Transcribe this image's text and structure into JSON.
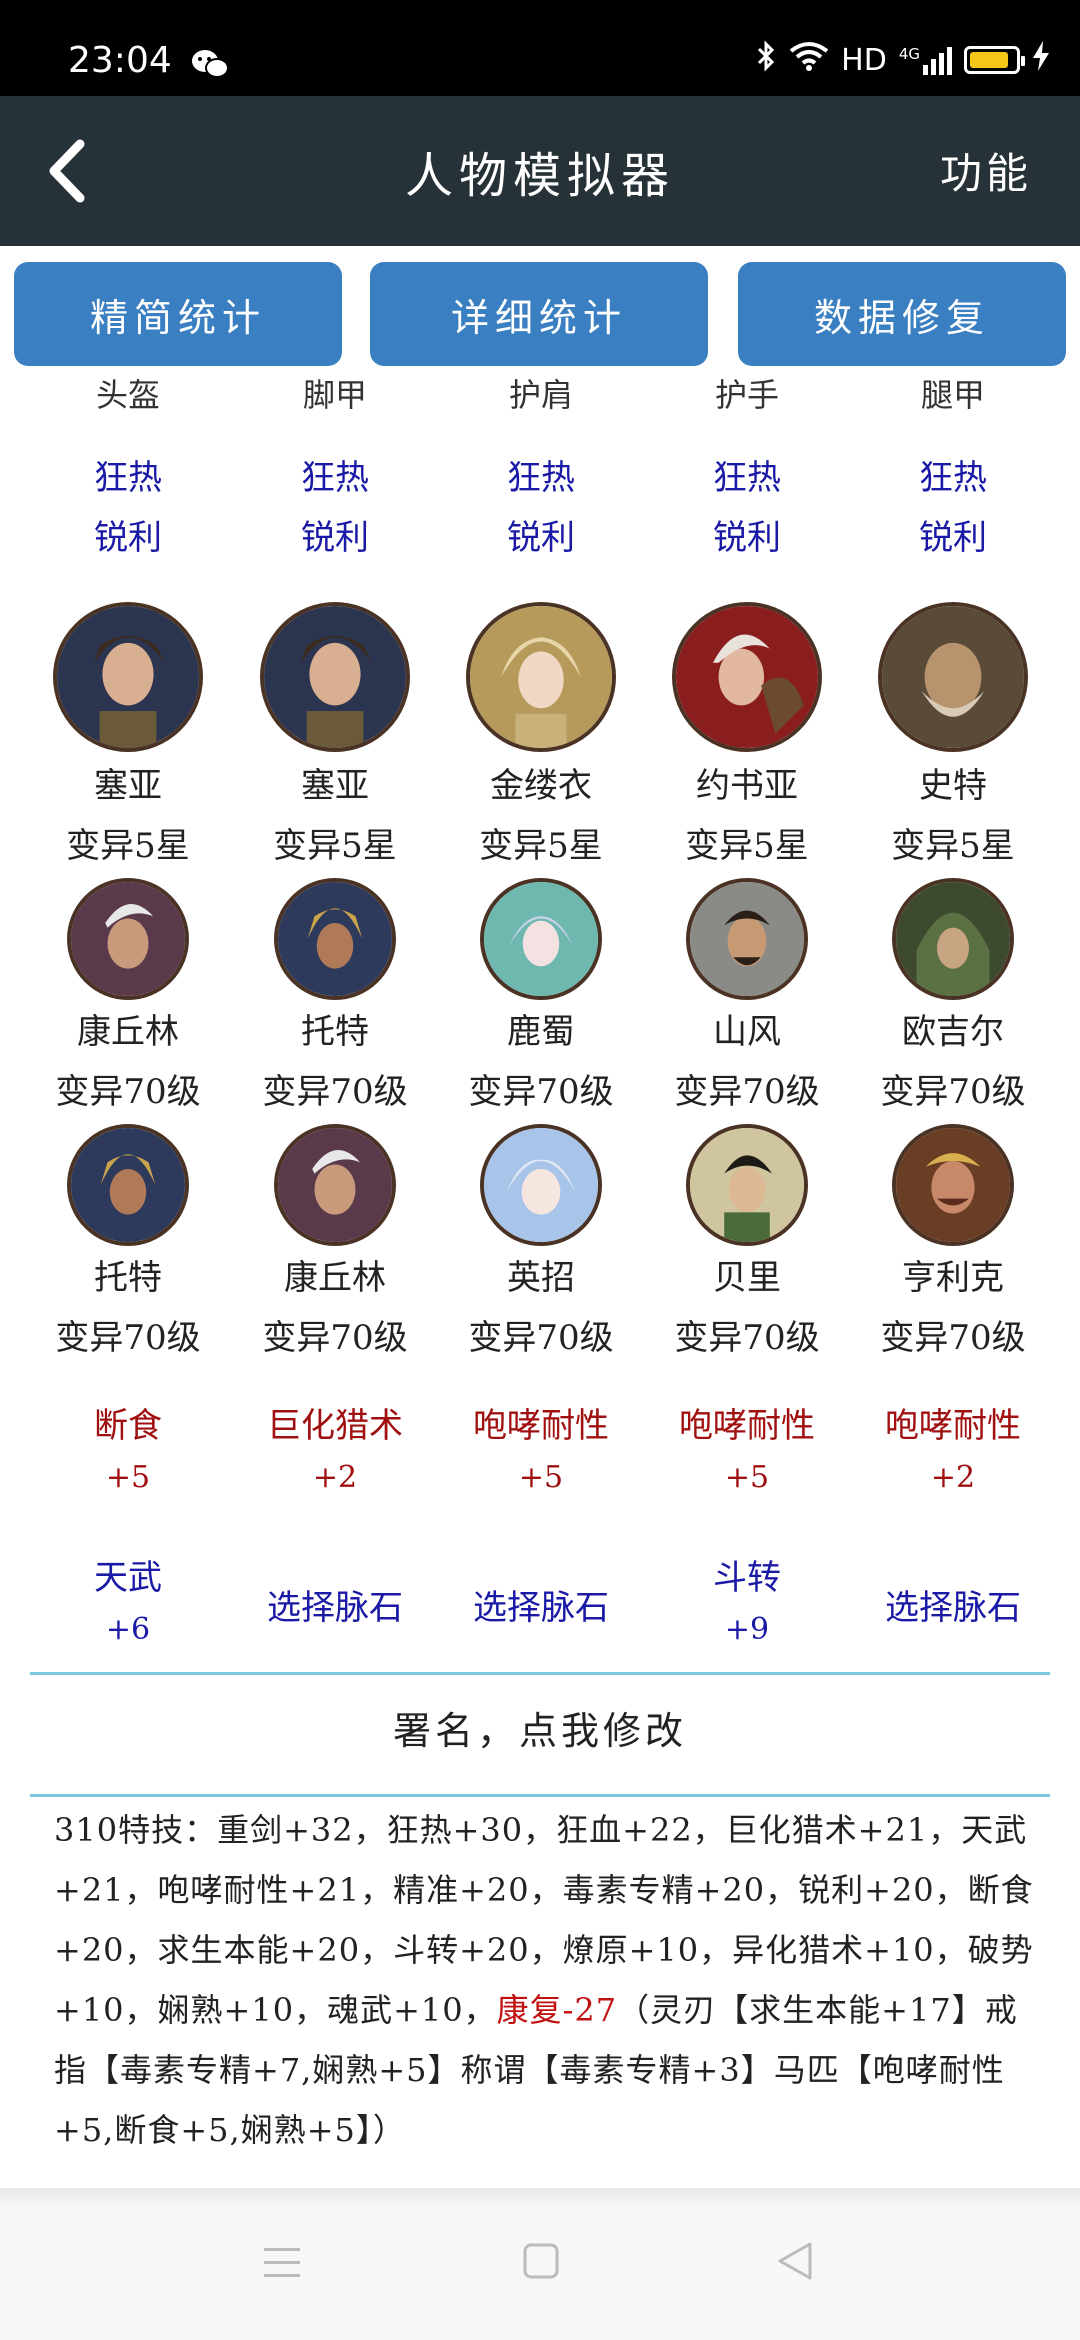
{
  "status_bar": {
    "time": "23:04",
    "network": "HD",
    "signal_label": "4G"
  },
  "header": {
    "title": "人物模拟器",
    "menu_label": "功能"
  },
  "tabs": [
    "精简统计",
    "详细统计",
    "数据修复"
  ],
  "equipment": [
    {
      "slot": "头盔",
      "attr1": "狂热",
      "attr2": "锐利"
    },
    {
      "slot": "脚甲",
      "attr1": "狂热",
      "attr2": "锐利"
    },
    {
      "slot": "护肩",
      "attr1": "狂热",
      "attr2": "锐利"
    },
    {
      "slot": "护手",
      "attr1": "狂热",
      "attr2": "锐利"
    },
    {
      "slot": "腿甲",
      "attr1": "狂热",
      "attr2": "锐利"
    }
  ],
  "leaders": [
    {
      "name": "塞亚",
      "level": "变异5星"
    },
    {
      "name": "塞亚",
      "level": "变异5星"
    },
    {
      "name": "金缕衣",
      "level": "变异5星"
    },
    {
      "name": "约书亚",
      "level": "变异5星"
    },
    {
      "name": "史特",
      "level": "变异5星"
    }
  ],
  "heroes_row2": [
    {
      "name": "康丘林",
      "level": "变异70级"
    },
    {
      "name": "托特",
      "level": "变异70级"
    },
    {
      "name": "鹿蜀",
      "level": "变异70级"
    },
    {
      "name": "山风",
      "level": "变异70级"
    },
    {
      "name": "欧吉尔",
      "level": "变异70级"
    }
  ],
  "heroes_row3": [
    {
      "name": "托特",
      "level": "变异70级"
    },
    {
      "name": "康丘林",
      "level": "变异70级"
    },
    {
      "name": "英招",
      "level": "变异70级"
    },
    {
      "name": "贝里",
      "level": "变异70级"
    },
    {
      "name": "亨利克",
      "level": "变异70级"
    }
  ],
  "skills": [
    {
      "name": "断食",
      "value": "+5"
    },
    {
      "name": "巨化猎术",
      "value": "+2"
    },
    {
      "name": "咆哮耐性",
      "value": "+5"
    },
    {
      "name": "咆哮耐性",
      "value": "+5"
    },
    {
      "name": "咆哮耐性",
      "value": "+2"
    }
  ],
  "veins": [
    {
      "name": "天武",
      "value": "+6"
    },
    {
      "name": "选择脉石",
      "value": ""
    },
    {
      "name": "选择脉石",
      "value": ""
    },
    {
      "name": "斗转",
      "value": "+9"
    },
    {
      "name": "选择脉石",
      "value": ""
    }
  ],
  "signature": "署名，点我修改",
  "summary": {
    "part1": "310特技：重剑+32，狂热+30，狂血+22，巨化猎术+21，天武+21，咆哮耐性+21，精准+20，毒素专精+20，锐利+20，断食+20，求生本能+20，斗转+20，燎原+10，异化猎术+10，破势+10，娴熟+10，魂武+10，",
    "negative": "康复-27",
    "part2": "（灵刃【求生本能+17】戒指【毒素专精+7,娴熟+5】称谓【毒素专精+3】马匹【咆哮耐性+5,断食+5,娴熟+5】）"
  },
  "colors": {
    "header_bg": "#263238",
    "tab_bg": "#3a7fc1",
    "attr_blue": "#1a1aa6",
    "skill_red": "#a01010",
    "negative_red": "#c01010",
    "divider": "#7ec7e0"
  },
  "icons": [
    "wechat-icon",
    "bluetooth-icon",
    "wifi-icon",
    "signal-icon",
    "battery-icon",
    "charging-icon",
    "back-icon",
    "menu-nav-icon",
    "home-nav-icon",
    "back-nav-icon"
  ]
}
